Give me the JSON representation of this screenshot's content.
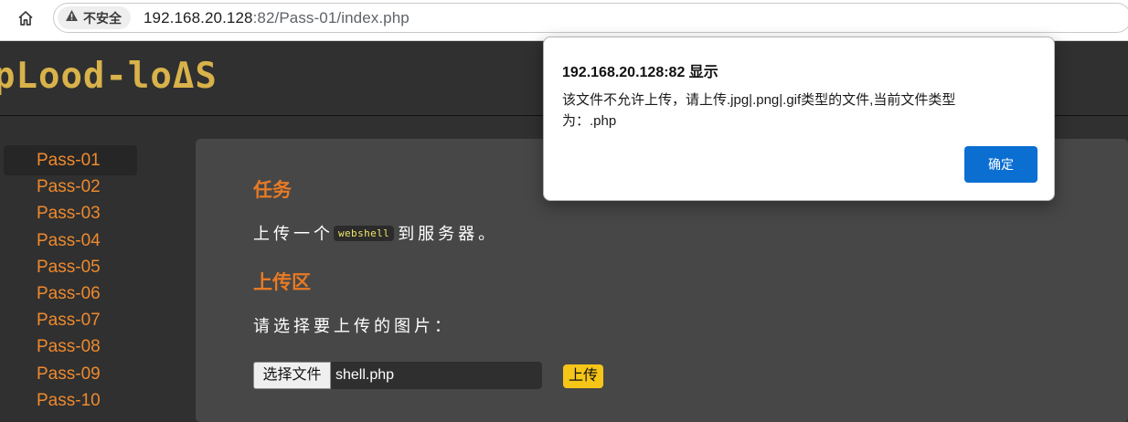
{
  "browser": {
    "security_label": "不安全",
    "url_host": "192.168.20.128",
    "url_rest": ":82/Pass-01/index.php"
  },
  "site": {
    "logo": "pLood-loΔS"
  },
  "sidebar": {
    "items": [
      {
        "label": "Pass-01",
        "active": true
      },
      {
        "label": "Pass-02"
      },
      {
        "label": "Pass-03"
      },
      {
        "label": "Pass-04"
      },
      {
        "label": "Pass-05"
      },
      {
        "label": "Pass-06"
      },
      {
        "label": "Pass-07"
      },
      {
        "label": "Pass-08"
      },
      {
        "label": "Pass-09"
      },
      {
        "label": "Pass-10"
      }
    ]
  },
  "main": {
    "task_title": "任务",
    "task_prefix": "上传一个",
    "task_code": "webshell",
    "task_suffix": "到服务器。",
    "upload_title": "上传区",
    "upload_prompt": "请选择要上传的图片：",
    "choose_file_label": "选择文件",
    "file_name": "shell.php",
    "upload_button": "上传"
  },
  "dialog": {
    "title": "192.168.20.128:82 显示",
    "message": "该文件不允许上传，请上传.jpg|.png|.gif类型的文件,当前文件类型为：.php",
    "ok_label": "确定"
  },
  "colors": {
    "accent_orange": "#e87a24",
    "logo_gold": "#d8b24a",
    "upload_yellow": "#f5c518",
    "dialog_blue": "#0b6fd1"
  }
}
